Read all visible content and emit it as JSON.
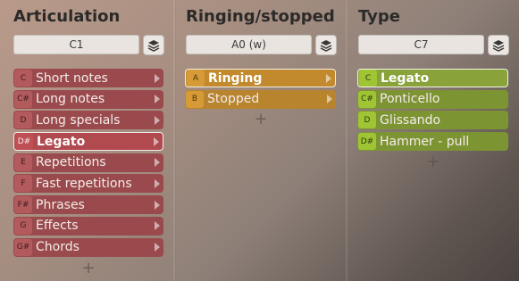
{
  "columns": [
    {
      "title": "Articulation",
      "key_value": "C1",
      "items": [
        {
          "key": "C",
          "label": "Short notes"
        },
        {
          "key": "C#",
          "label": "Long notes"
        },
        {
          "key": "D",
          "label": "Long specials"
        },
        {
          "key": "D#",
          "label": "Legato",
          "selected": true
        },
        {
          "key": "E",
          "label": "Repetitions"
        },
        {
          "key": "F",
          "label": "Fast repetitions"
        },
        {
          "key": "F#",
          "label": "Phrases"
        },
        {
          "key": "G",
          "label": "Effects"
        },
        {
          "key": "G#",
          "label": "Chords"
        }
      ],
      "color": "#9a4a4c"
    },
    {
      "title": "Ringing/stopped",
      "key_value": "A0 (w)",
      "items": [
        {
          "key": "A",
          "label": "Ringing",
          "selected": true
        },
        {
          "key": "B",
          "label": "Stopped"
        }
      ],
      "color": "#b8842e"
    },
    {
      "title": "Type",
      "key_value": "C7",
      "items": [
        {
          "key": "C",
          "label": "Legato",
          "selected": true
        },
        {
          "key": "C#",
          "label": "Ponticello"
        },
        {
          "key": "D",
          "label": "Glissando"
        },
        {
          "key": "D#",
          "label": "Hammer - pull"
        }
      ],
      "color": "#7d9433"
    }
  ],
  "add_symbol": "+"
}
